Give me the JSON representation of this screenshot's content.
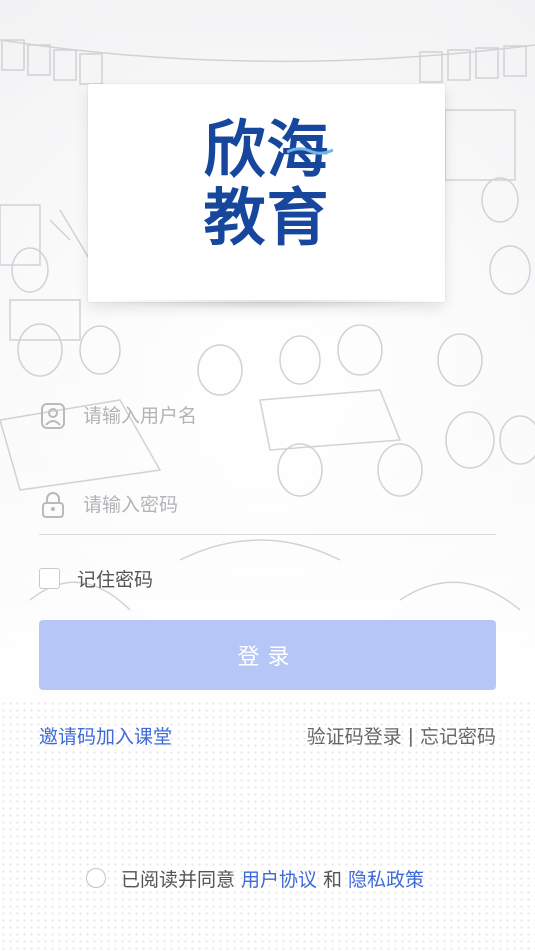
{
  "logo": {
    "line1": "欣海",
    "line2": "教育",
    "color": "#17479c"
  },
  "form": {
    "username_placeholder": "请输入用户名",
    "password_placeholder": "请输入密码",
    "remember_label": "记住密码",
    "remember_checked": false,
    "login_label": "登录"
  },
  "links": {
    "invite": "邀请码加入课堂",
    "sms_login": "验证码登录",
    "separator": "|",
    "forgot": "忘记密码"
  },
  "agreement": {
    "prefix": "已阅读并同意",
    "user_agreement": "用户协议",
    "and": "和",
    "privacy": "隐私政策",
    "checked": false
  },
  "icons": {
    "user": "user-icon",
    "lock": "lock-icon"
  },
  "colors": {
    "accent": "#3e6ad8",
    "button": "#b6c6f7",
    "brand": "#17479c"
  }
}
